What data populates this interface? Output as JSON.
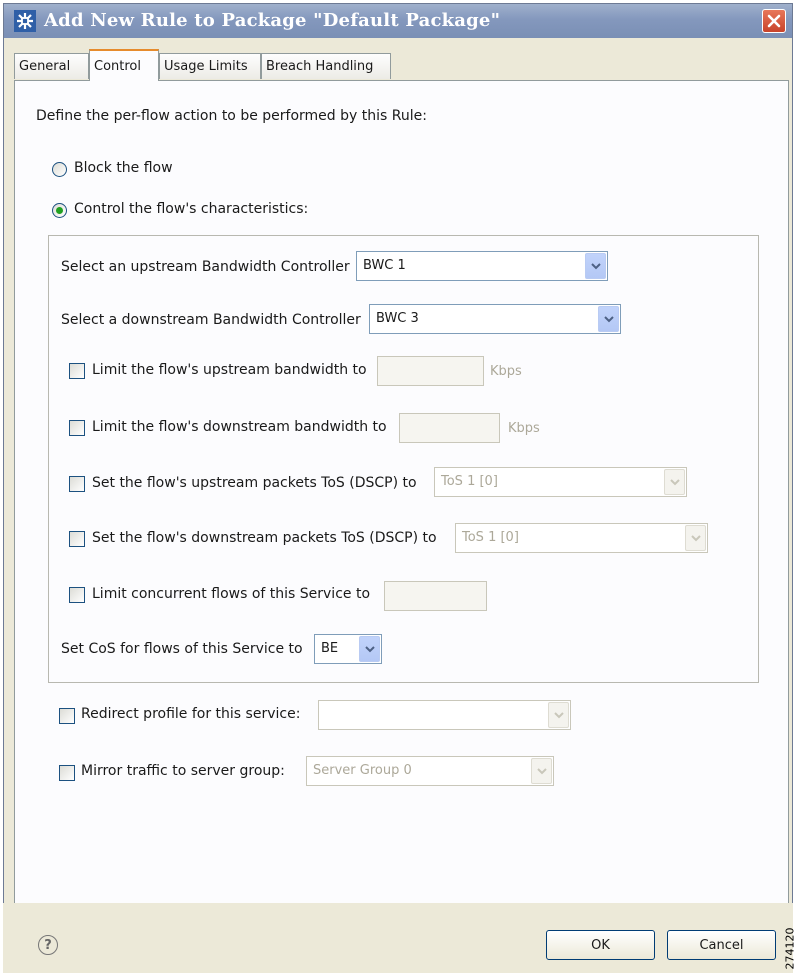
{
  "window": {
    "title": "Add New Rule to Package \"Default Package\"",
    "app_icon": "app-logo-icon",
    "close_icon": "close-icon"
  },
  "tabs": [
    {
      "label": "General",
      "active": false
    },
    {
      "label": "Control",
      "active": true
    },
    {
      "label": "Usage Limits",
      "active": false
    },
    {
      "label": "Breach Handling",
      "active": false
    }
  ],
  "control": {
    "heading": "Define the per-flow action to be performed by this Rule:",
    "radio_block": {
      "label": "Block the flow",
      "selected": false
    },
    "radio_control": {
      "label": "Control the flow's characteristics:",
      "selected": true
    },
    "upstream_bwc": {
      "label": "Select an upstream Bandwidth Controller",
      "value": "BWC 1"
    },
    "downstream_bwc": {
      "label": "Select a downstream Bandwidth Controller",
      "value": "BWC 3"
    },
    "limit_upstream": {
      "label": "Limit the flow's upstream bandwidth to",
      "checked": false,
      "value": "",
      "unit": "Kbps"
    },
    "limit_downstream": {
      "label": "Limit the flow's downstream bandwidth to",
      "checked": false,
      "value": "",
      "unit": "Kbps"
    },
    "tos_upstream": {
      "label": "Set the flow's upstream packets ToS (DSCP) to",
      "checked": false,
      "value": "ToS 1 [0]"
    },
    "tos_downstream": {
      "label": "Set the flow's downstream packets ToS (DSCP) to",
      "checked": false,
      "value": "ToS 1 [0]"
    },
    "concurrent_flows": {
      "label": "Limit concurrent flows of this Service to",
      "checked": false,
      "value": ""
    },
    "cos": {
      "label": "Set CoS for flows of this Service to",
      "value": "BE"
    },
    "redirect": {
      "label": "Redirect profile for this service:",
      "checked": false,
      "value": ""
    },
    "mirror": {
      "label": "Mirror traffic to server group:",
      "checked": false,
      "value": "Server Group 0"
    }
  },
  "footer": {
    "help_icon": "help-icon",
    "help_glyph": "?",
    "ok_label": "OK",
    "cancel_label": "Cancel",
    "figure_id": "274120"
  }
}
